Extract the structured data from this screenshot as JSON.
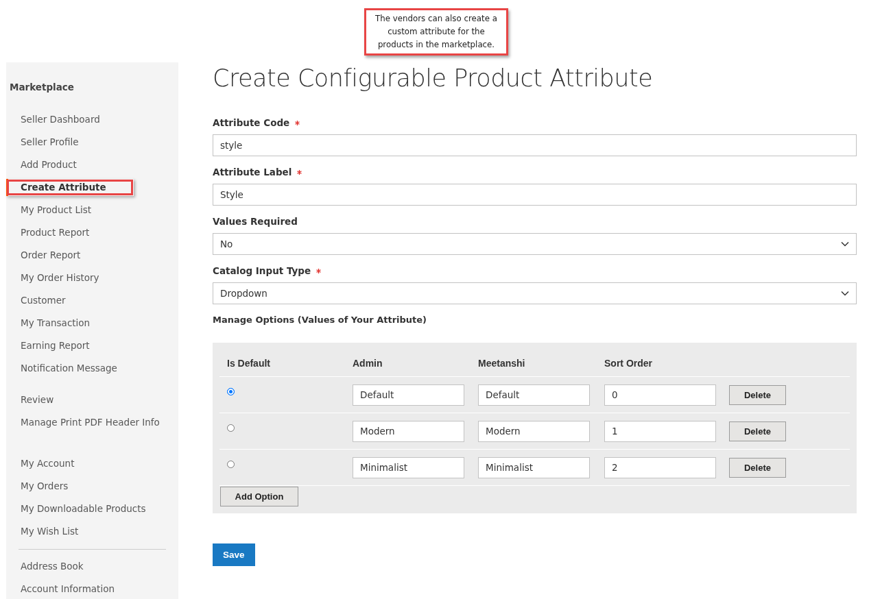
{
  "callout": {
    "text": "The vendors can also create a custom attribute for the products in the marketplace."
  },
  "sidebar": {
    "title": "Marketplace",
    "sections": [
      {
        "divider": false,
        "items": [
          {
            "label": "Seller Dashboard",
            "selected": false,
            "highlighted": false
          },
          {
            "label": "Seller Profile",
            "selected": false,
            "highlighted": false
          },
          {
            "label": "Add Product",
            "selected": false,
            "highlighted": false
          },
          {
            "label": "Create Attribute",
            "selected": true,
            "highlighted": true
          },
          {
            "label": "My Product List",
            "selected": false,
            "highlighted": false
          },
          {
            "label": "Product Report",
            "selected": false,
            "highlighted": false
          },
          {
            "label": "Order Report",
            "selected": false,
            "highlighted": false
          },
          {
            "label": "My Order History",
            "selected": false,
            "highlighted": false
          },
          {
            "label": "Customer",
            "selected": false,
            "highlighted": false
          },
          {
            "label": "My Transaction",
            "selected": false,
            "highlighted": false
          },
          {
            "label": "Earning Report",
            "selected": false,
            "highlighted": false
          },
          {
            "label": "Notification Message",
            "selected": false,
            "highlighted": false
          }
        ]
      },
      {
        "divider": false,
        "items": [
          {
            "label": "Review",
            "selected": false,
            "highlighted": false
          },
          {
            "label": "Manage Print PDF Header Info",
            "selected": false,
            "highlighted": false
          }
        ]
      },
      {
        "divider": false,
        "items": [
          {
            "label": "My Account",
            "selected": false,
            "highlighted": false
          },
          {
            "label": "My Orders",
            "selected": false,
            "highlighted": false
          },
          {
            "label": "My Downloadable Products",
            "selected": false,
            "highlighted": false
          },
          {
            "label": "My Wish List",
            "selected": false,
            "highlighted": false
          }
        ]
      },
      {
        "divider": true,
        "items": [
          {
            "label": "Address Book",
            "selected": false,
            "highlighted": false
          },
          {
            "label": "Account Information",
            "selected": false,
            "highlighted": false
          }
        ]
      }
    ]
  },
  "page_title": "Create Configurable Product Attribute",
  "fields": [
    {
      "kind": "text",
      "label": "Attribute Code",
      "required": true,
      "value": "style"
    },
    {
      "kind": "text",
      "label": "Attribute Label",
      "required": true,
      "value": "Style"
    },
    {
      "kind": "select",
      "label": "Values Required",
      "required": false,
      "value": "No"
    },
    {
      "kind": "select",
      "label": "Catalog Input Type",
      "required": true,
      "value": "Dropdown"
    }
  ],
  "options": {
    "title": "Manage Options (Values of Your Attribute)",
    "columns": [
      "Is Default",
      "Admin",
      "Meetanshi",
      "Sort Order"
    ],
    "rows": [
      {
        "selected": true,
        "admin": "Default",
        "store": "Default",
        "sort_order": "0",
        "delete": "Delete"
      },
      {
        "selected": false,
        "admin": "Modern",
        "store": "Modern",
        "sort_order": "1",
        "delete": "Delete"
      },
      {
        "selected": false,
        "admin": "Minimalist",
        "store": "Minimalist",
        "sort_order": "2",
        "delete": "Delete"
      }
    ],
    "add_button": "Add Option"
  },
  "save_button": "Save"
}
